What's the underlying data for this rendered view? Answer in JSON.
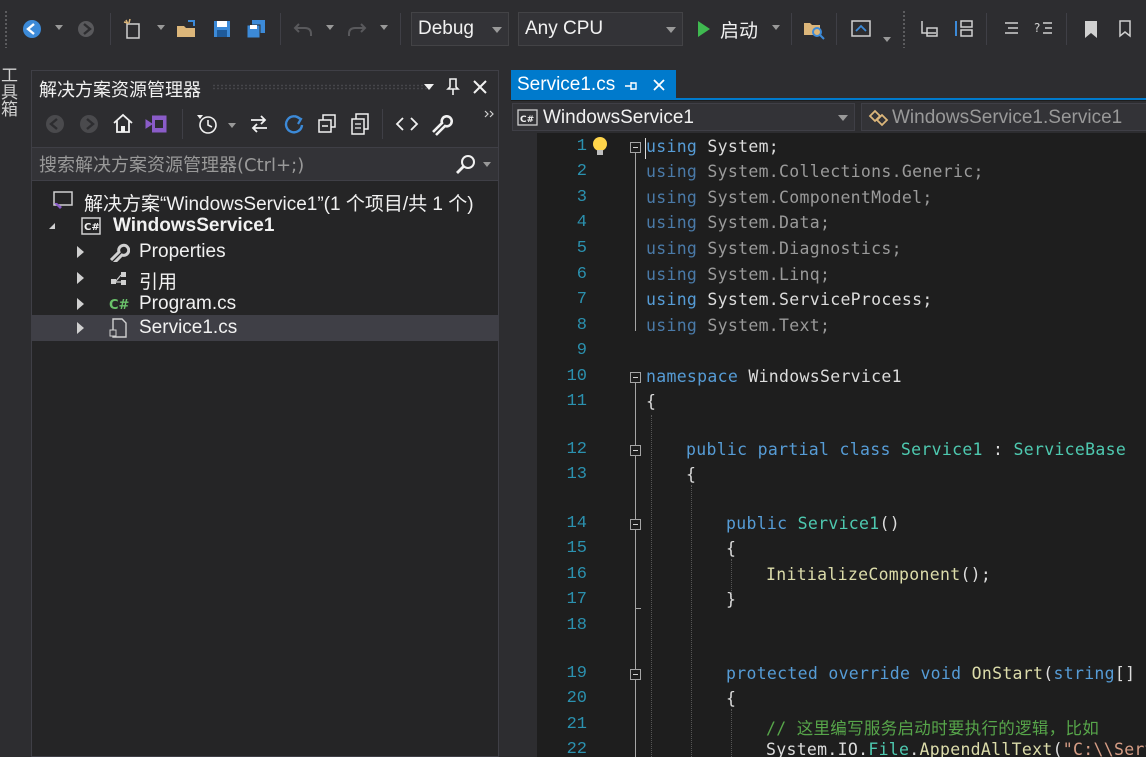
{
  "toolbar": {
    "config_value": "Debug",
    "platform_value": "Any CPU",
    "run_label": "启动"
  },
  "toolbox": {
    "label": "工具箱"
  },
  "solution_explorer": {
    "title": "解决方案资源管理器",
    "search_placeholder": "搜索解决方案资源管理器(Ctrl+;)",
    "tree": [
      {
        "label": "解决方案“WindowsService1”(1 个项目/共 1 个)"
      },
      {
        "label": "WindowsService1"
      },
      {
        "label": "Properties"
      },
      {
        "label": "引用"
      },
      {
        "label": "Program.cs"
      },
      {
        "label": "Service1.cs"
      }
    ]
  },
  "editor": {
    "tab_label": "Service1.cs",
    "nav_left": "WindowsService1",
    "nav_right": "WindowsService1.Service1",
    "line_numbers": [
      "1",
      "2",
      "3",
      "4",
      "5",
      "6",
      "7",
      "8",
      "9",
      "10",
      "11",
      "12",
      "13",
      "14",
      "15",
      "16",
      "17",
      "18",
      "19",
      "20",
      "21",
      "22"
    ],
    "code": {
      "l1_kw": "using",
      "l1_rest": " System;",
      "l2_kw": "using",
      "l2_rest": " System.Collections.Generic;",
      "l3_kw": "using",
      "l3_rest": " System.ComponentModel;",
      "l4_kw": "using",
      "l4_rest": " System.Data;",
      "l5_kw": "using",
      "l5_rest": " System.Diagnostics;",
      "l6_kw": "using",
      "l6_rest": " System.Linq;",
      "l7_kw": "using",
      "l7_rest": " System.ServiceProcess;",
      "l8_kw": "using",
      "l8_rest": " System.Text;",
      "l10_kw": "namespace",
      "l10_rest": " WindowsService1",
      "l11": "{",
      "l12_kw1": "public",
      "l12_kw2": "partial",
      "l12_kw3": "class",
      "l12_cls": "Service1",
      "l12_colon": " : ",
      "l12_base": "ServiceBase",
      "l13": "{",
      "l14_kw": "public",
      "l14_name": "Service1",
      "l14_paren": "()",
      "l15": "{",
      "l16_fn": "InitializeComponent",
      "l16_rest": "();",
      "l17": "}",
      "l19_kw1": "protected",
      "l19_kw2": "override",
      "l19_kw3": "void",
      "l19_fn": "OnStart",
      "l19_p": "(",
      "l19_ty": "string",
      "l19_rest": "[] a",
      "l20": "{",
      "l21_cm": "// 这里编写服务启动时要执行的逻辑，比如",
      "l22_a": "System.IO.",
      "l22_ty": "File",
      "l22_b": ".",
      "l22_fn": "AppendAllText",
      "l22_c": "(",
      "l22_st": "\"C:\\\\Serv"
    }
  }
}
